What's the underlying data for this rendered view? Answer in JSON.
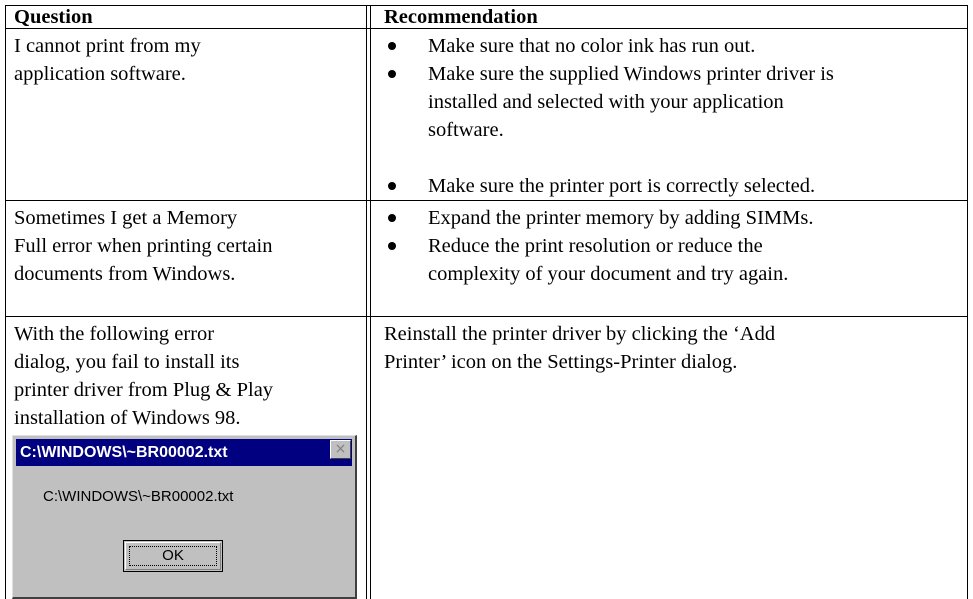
{
  "table": {
    "headers": {
      "question": "Question",
      "recommendation": "Recommendation"
    },
    "rows": [
      {
        "question_lines": [
          "I cannot print from my",
          "application software."
        ],
        "recommendations": [
          {
            "lines": [
              "Make sure that no color ink has run out."
            ]
          },
          {
            "lines": [
              "Make sure the supplied Windows printer driver is",
              "installed and selected with your application",
              "software."
            ]
          },
          {
            "lines": [
              "Make sure the printer port is correctly selected."
            ]
          }
        ]
      },
      {
        "question_lines": [
          "Sometimes I get a Memory",
          "Full error when printing certain",
          "documents from Windows."
        ],
        "recommendations": [
          {
            "lines": [
              "Expand the printer memory by adding SIMMs."
            ]
          },
          {
            "lines": [
              "Reduce the print resolution or reduce the",
              "complexity of your document and try again."
            ]
          }
        ]
      },
      {
        "question_lines": [
          "With the following error",
          "dialog, you fail to install its",
          "printer driver from Plug & Play",
          "installation of Windows 98."
        ],
        "recommendation_lines": [
          "Reinstall the printer driver by clicking the ‘Add",
          "Printer’ icon on the Settings-Printer dialog."
        ]
      }
    ]
  },
  "dialog": {
    "title": "C:\\WINDOWS\\~BR00002.txt",
    "message": "C:\\WINDOWS\\~BR00002.txt",
    "ok_label": "OK",
    "close_glyph": "×"
  }
}
